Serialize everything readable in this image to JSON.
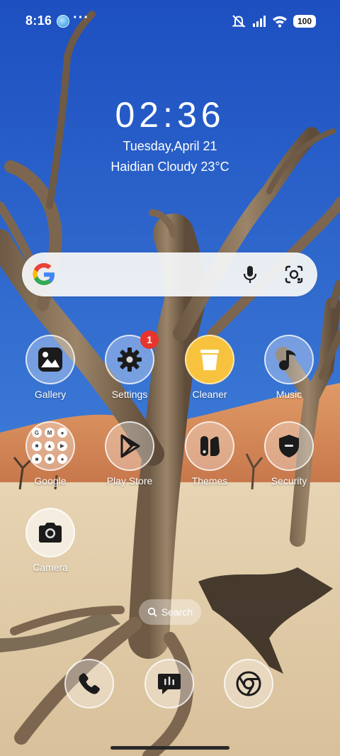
{
  "status_bar": {
    "time": "8:16",
    "more": "···",
    "battery": "100",
    "icons": [
      "app-notification-icon",
      "mute-icon",
      "signal-icon",
      "wifi-icon",
      "battery-icon"
    ]
  },
  "clock": {
    "time": "02:36",
    "date": "Tuesday,April 21",
    "weather": "Haidian Cloudy 23°C"
  },
  "search_bar": {
    "icons": [
      "google-logo",
      "mic-icon",
      "lens-icon"
    ]
  },
  "apps": [
    {
      "label": "Gallery",
      "icon": "gallery-icon"
    },
    {
      "label": "Settings",
      "icon": "gear-icon",
      "badge": "1"
    },
    {
      "label": "Cleaner",
      "icon": "trash-icon"
    },
    {
      "label": "Music",
      "icon": "music-note-icon"
    },
    {
      "label": "Google",
      "icon": "folder-icon"
    },
    {
      "label": "Play Store",
      "icon": "play-store-icon"
    },
    {
      "label": "Themes",
      "icon": "themes-icon"
    },
    {
      "label": "Security",
      "icon": "shield-icon"
    },
    {
      "label": "Camera",
      "icon": "camera-icon"
    }
  ],
  "folder_google": {
    "mini_icons": [
      "G",
      "M",
      "●",
      "■",
      "▲",
      "▶",
      "■",
      "✱",
      "●"
    ]
  },
  "page_search": {
    "label": "Search"
  },
  "dock": [
    {
      "name": "phone",
      "icon": "phone-icon"
    },
    {
      "name": "messages",
      "icon": "messages-icon"
    },
    {
      "name": "chrome",
      "icon": "chrome-icon"
    }
  ],
  "colors": {
    "sky_top": "#1f56c4",
    "sky_bottom": "#6fa3d8",
    "dune": "#d98a5a",
    "ground": "#e6d2b0",
    "badge": "#e8342c",
    "cleaner": "#f7c33f"
  }
}
